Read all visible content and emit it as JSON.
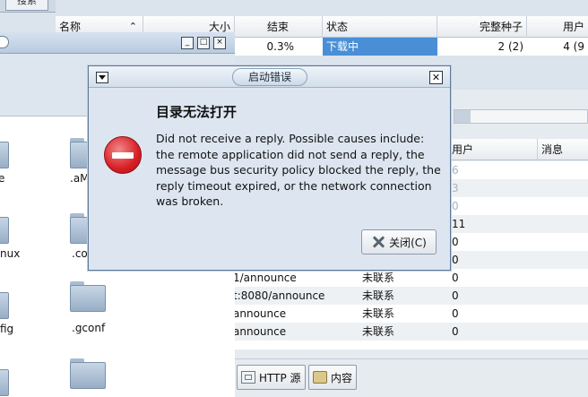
{
  "search": {
    "tab_label": "搜索"
  },
  "torrent_table": {
    "headers": {
      "name": "名称",
      "size": "大小",
      "done": "结束",
      "status": "状态",
      "seeds": "完整种子",
      "peers": "用户"
    },
    "row": {
      "done": "0.3%",
      "status": "下载中",
      "seeds": "2 (2)",
      "peers": "4 (9"
    }
  },
  "file_manager": {
    "window_buttons": {
      "minimize": "_",
      "maximize": "□",
      "close": "×"
    },
    "items": [
      {
        "label": "e"
      },
      {
        "label": ".aM"
      },
      {
        "label": "nux"
      },
      {
        "label": ".co"
      },
      {
        "label": "fig"
      },
      {
        "label": ".gconf"
      }
    ]
  },
  "trackers": {
    "headers": {
      "peers": "用户",
      "messages": "消息"
    },
    "rows": [
      {
        "url": "",
        "status": "",
        "peers": "6",
        "grey": true
      },
      {
        "url": "",
        "status": "",
        "peers": "3",
        "grey": true
      },
      {
        "url": "",
        "status": "",
        "peers": "0",
        "grey": true
      },
      {
        "url": "",
        "status": "",
        "peers": "11",
        "grey": false
      },
      {
        "url": "",
        "status": "",
        "peers": "0",
        "grey": false
      },
      {
        "url": "",
        "status": "",
        "peers": "0",
        "grey": false
      },
      {
        "url": "1/announce",
        "status": "未联系",
        "peers": "0",
        "grey": false
      },
      {
        "url": "t:8080/announce",
        "status": "未联系",
        "peers": "0",
        "grey": false
      },
      {
        "url": "announce",
        "status": "未联系",
        "peers": "0",
        "grey": false
      },
      {
        "url": "announce",
        "status": "未联系",
        "peers": "0",
        "grey": false
      }
    ],
    "tool_buttons": {
      "http_sources": "HTTP 源",
      "content": "内容"
    }
  },
  "dialog": {
    "title": "启动错误",
    "heading": "目录无法打开",
    "message": "Did not receive a reply. Possible causes include: the remote application did not send a reply, the message bus security policy blocked the reply, the reply timeout expired, or the network connection was broken.",
    "close_button": "关闭(C)",
    "close_glyph": "✕",
    "icon": "error-icon",
    "colors": {
      "accent": "#4a8fd6",
      "error": "#d61f25"
    }
  }
}
